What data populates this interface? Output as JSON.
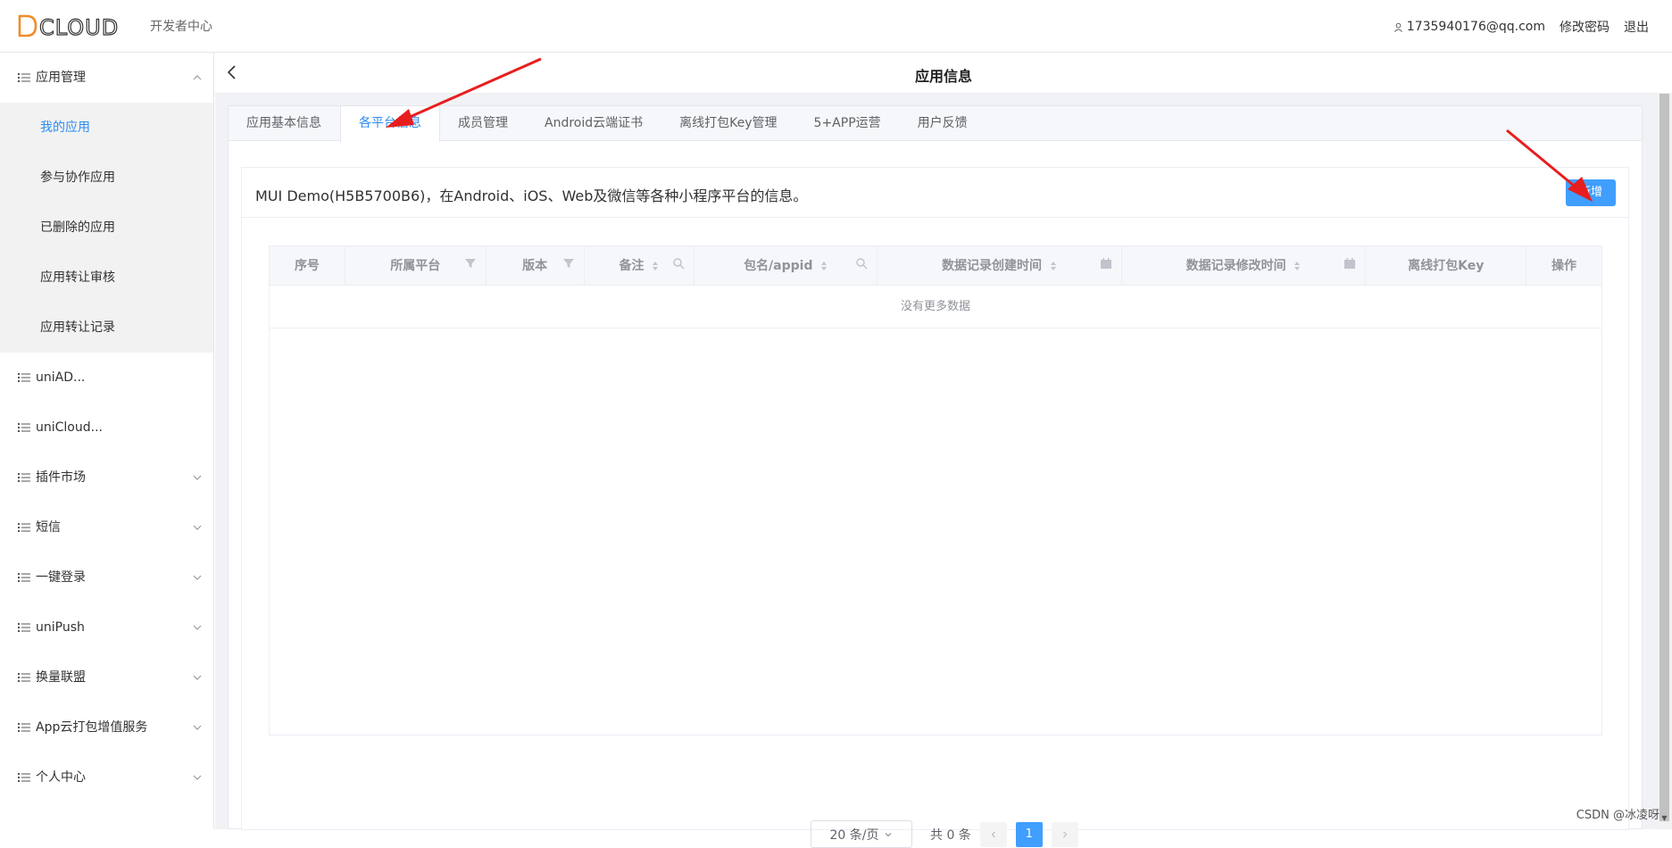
{
  "header": {
    "logo_text": "DCLOUD",
    "subtitle": "开发者中心",
    "user": "1735940176@qq.com",
    "change_password": "修改密码",
    "logout": "退出"
  },
  "sidebar": {
    "groups": [
      {
        "label": "应用管理",
        "expanded": true
      },
      {
        "label": "uniAD..."
      },
      {
        "label": "uniCloud..."
      },
      {
        "label": "插件市场"
      },
      {
        "label": "短信"
      },
      {
        "label": "一键登录"
      },
      {
        "label": "uniPush"
      },
      {
        "label": "换量联盟"
      },
      {
        "label": "App云打包增值服务"
      },
      {
        "label": "个人中心"
      }
    ],
    "app_submenu": [
      "我的应用",
      "参与协作应用",
      "已删除的应用",
      "应用转让审核",
      "应用转让记录"
    ]
  },
  "page": {
    "title": "应用信息"
  },
  "tabs": [
    "应用基本信息",
    "各平台信息",
    "成员管理",
    "Android云端证书",
    "离线打包Key管理",
    "5+APP运营",
    "用户反馈"
  ],
  "panel": {
    "title": "MUI Demo(H5B5700B6)，在Android、iOS、Web及微信等各种小程序平台的信息。",
    "add_button": "新增"
  },
  "table": {
    "columns": [
      "序号",
      "所属平台",
      "版本",
      "备注",
      "包名/appid",
      "数据记录创建时间",
      "数据记录修改时间",
      "离线打包Key",
      "操作"
    ],
    "empty_text": "没有更多数据"
  },
  "pagination": {
    "page_size": "20 条/页",
    "total": "共 0 条",
    "current_page": "1"
  },
  "watermark": "CSDN @冰凌呀",
  "colors": {
    "primary": "#409eff",
    "arrow": "#e81e1e"
  }
}
